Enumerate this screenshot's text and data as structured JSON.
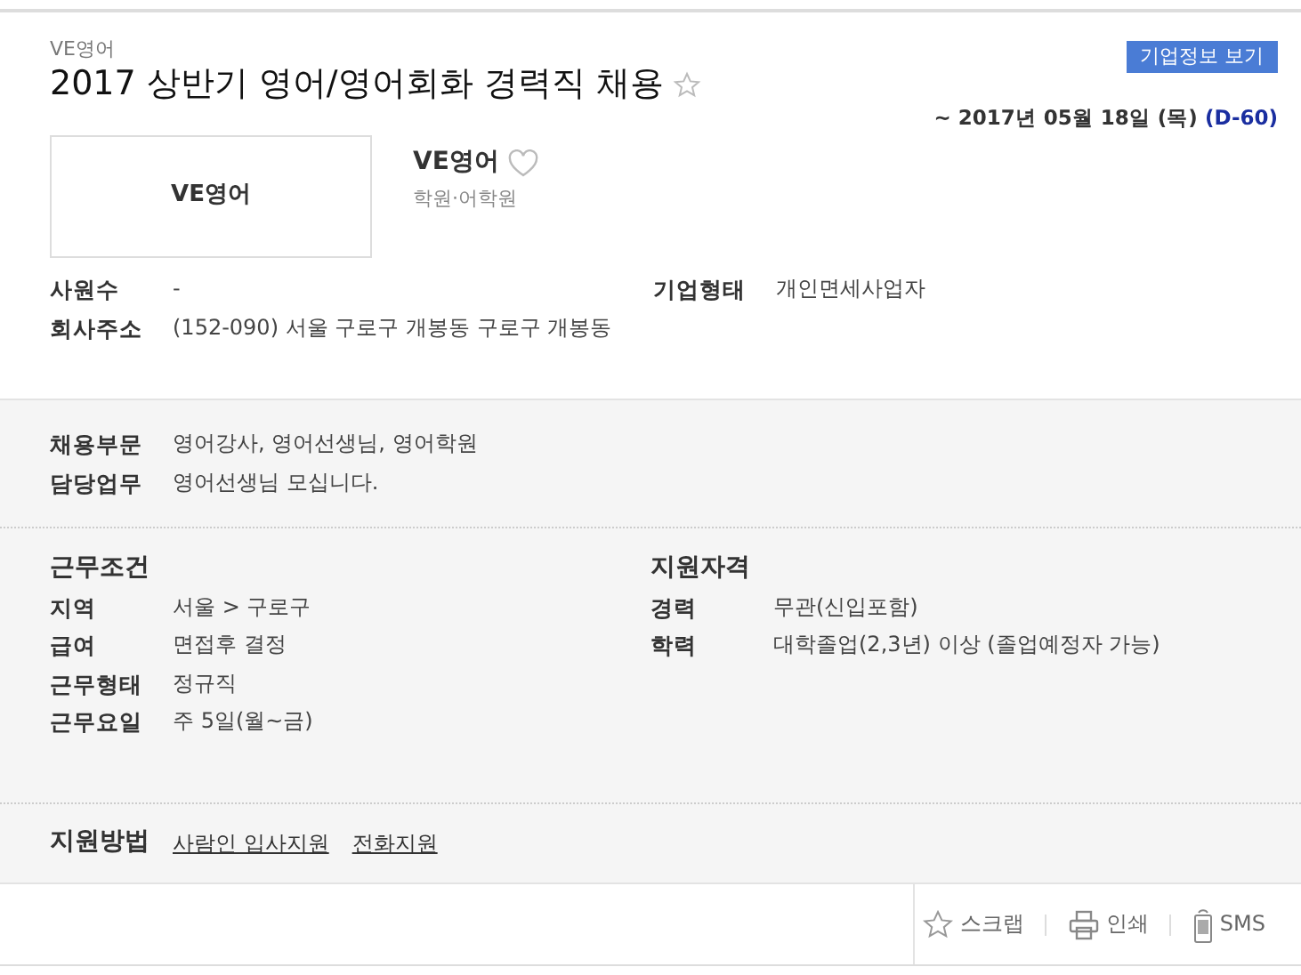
{
  "company_label": "VE영어",
  "title": "2017 상반기 영어/영어회화 경력직 채용",
  "company_info_button": "기업정보 보기",
  "deadline": {
    "date": "~ 2017년 05월 18일 (목)",
    "d_day": "(D-60)"
  },
  "logo_text": "VE영어",
  "company": {
    "name": "VE영어",
    "category": "학원·어학원"
  },
  "company_details": [
    {
      "label": "사원수",
      "value": "-"
    },
    {
      "label": "기업형태",
      "value": "개인면세사업자"
    },
    {
      "label": "회사주소",
      "value": "(152-090) 서울 구로구 개봉동 구로구 개봉동"
    }
  ],
  "job": [
    {
      "label": "채용부문",
      "value": "영어강사, 영어선생님, 영어학원"
    },
    {
      "label": "담당업무",
      "value": "영어선생님 모십니다."
    }
  ],
  "work_conditions": {
    "heading": "근무조건",
    "rows": [
      {
        "label": "지역",
        "value": "서울 > 구로구"
      },
      {
        "label": "급여",
        "value": "면접후 결정"
      },
      {
        "label": "근무형태",
        "value": "정규직"
      },
      {
        "label": "근무요일",
        "value": "주 5일(월~금)"
      }
    ]
  },
  "qualifications": {
    "heading": "지원자격",
    "rows": [
      {
        "label": "경력",
        "value": "무관(신입포함)"
      },
      {
        "label": "학력",
        "value": "대학졸업(2,3년) 이상 (졸업예정자 가능)"
      }
    ]
  },
  "apply": {
    "heading": "지원방법",
    "links": [
      "사람인 입사지원",
      "전화지원"
    ]
  },
  "actions": [
    {
      "kind": "scrap",
      "label": "스크랩"
    },
    {
      "kind": "print",
      "label": "인쇄"
    },
    {
      "kind": "sms",
      "label": "SMS"
    }
  ]
}
